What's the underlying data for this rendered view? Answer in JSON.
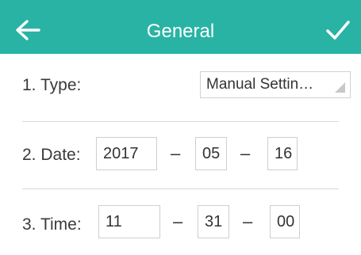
{
  "header": {
    "title": "General",
    "back_icon": "arrow-left-icon",
    "confirm_icon": "checkmark-icon",
    "color": "#28b3a5"
  },
  "form": {
    "type": {
      "label": "1. Type:",
      "value": "Manual Settin…"
    },
    "date": {
      "label": "2. Date:",
      "year": "2017",
      "sep1": "–",
      "month": "05",
      "sep2": "–",
      "day": "16"
    },
    "time": {
      "label": "3. Time:",
      "hour": "11",
      "sep1": "–",
      "minute": "31",
      "sep2": "–",
      "second": "00"
    }
  }
}
